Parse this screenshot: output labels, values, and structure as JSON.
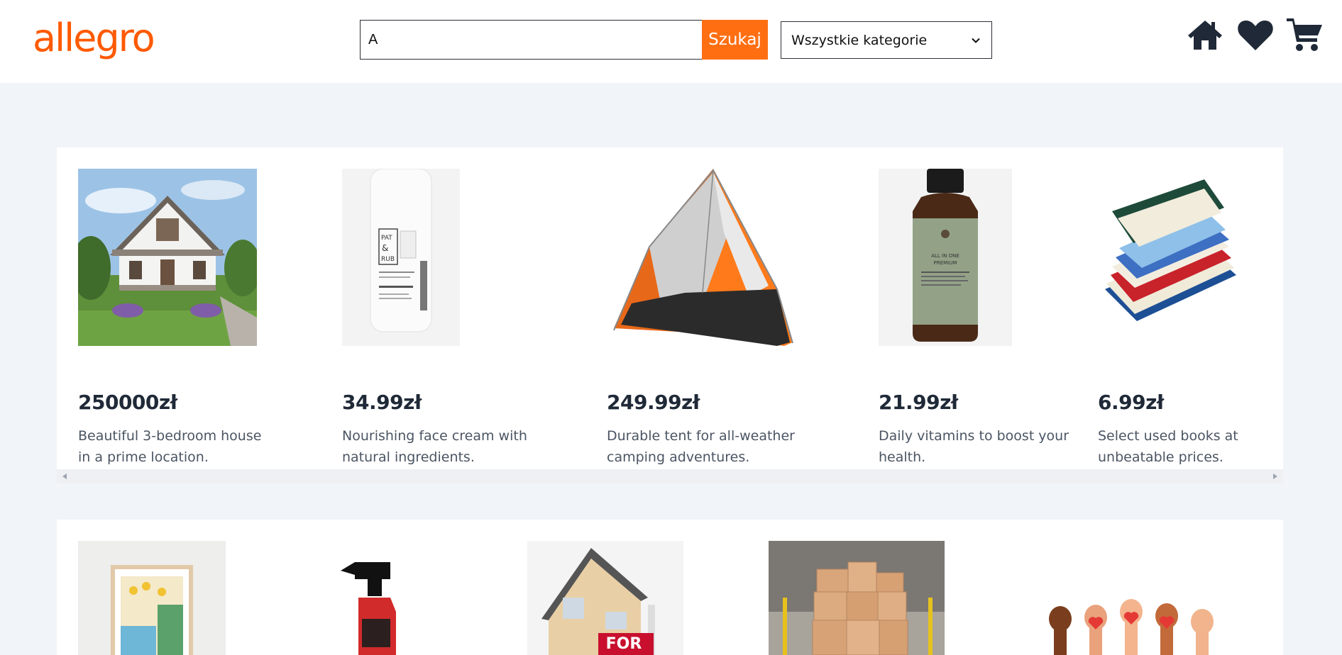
{
  "header": {
    "logo_text": "allegro",
    "search": {
      "value": "A",
      "button_label": "Szukaj"
    },
    "category": {
      "selected": "Wszystkie kategorie"
    },
    "icons": [
      "home-icon",
      "heart-icon",
      "cart-icon"
    ]
  },
  "colors": {
    "brand": "#ff5a00",
    "search_button": "#ff6f12",
    "page_bg": "#f1f4f8"
  },
  "products_row1": [
    {
      "price": "250000zł",
      "description": "Beautiful 3-bedroom house in a prime location.",
      "image": "house-photo"
    },
    {
      "price": "34.99zł",
      "description": "Nourishing face cream with natural ingredients.",
      "image": "face-cream-photo"
    },
    {
      "price": "249.99zł",
      "description": "Durable tent for all-weather camping adventures.",
      "image": "tent-photo"
    },
    {
      "price": "21.99zł",
      "description": "Daily vitamins to boost your health.",
      "image": "vitamins-bottle-photo"
    },
    {
      "price": "6.99zł",
      "description": "Select used books at unbeatable prices.",
      "image": "books-stack-photo"
    }
  ],
  "products_row2": [
    {
      "image": "framed-poster-photo"
    },
    {
      "image": "spray-bottle-photo"
    },
    {
      "image": "house-for-sale-photo",
      "sign_text": "FOR"
    },
    {
      "image": "cardboard-boxes-photo"
    },
    {
      "image": "raised-hands-hearts-photo"
    }
  ]
}
